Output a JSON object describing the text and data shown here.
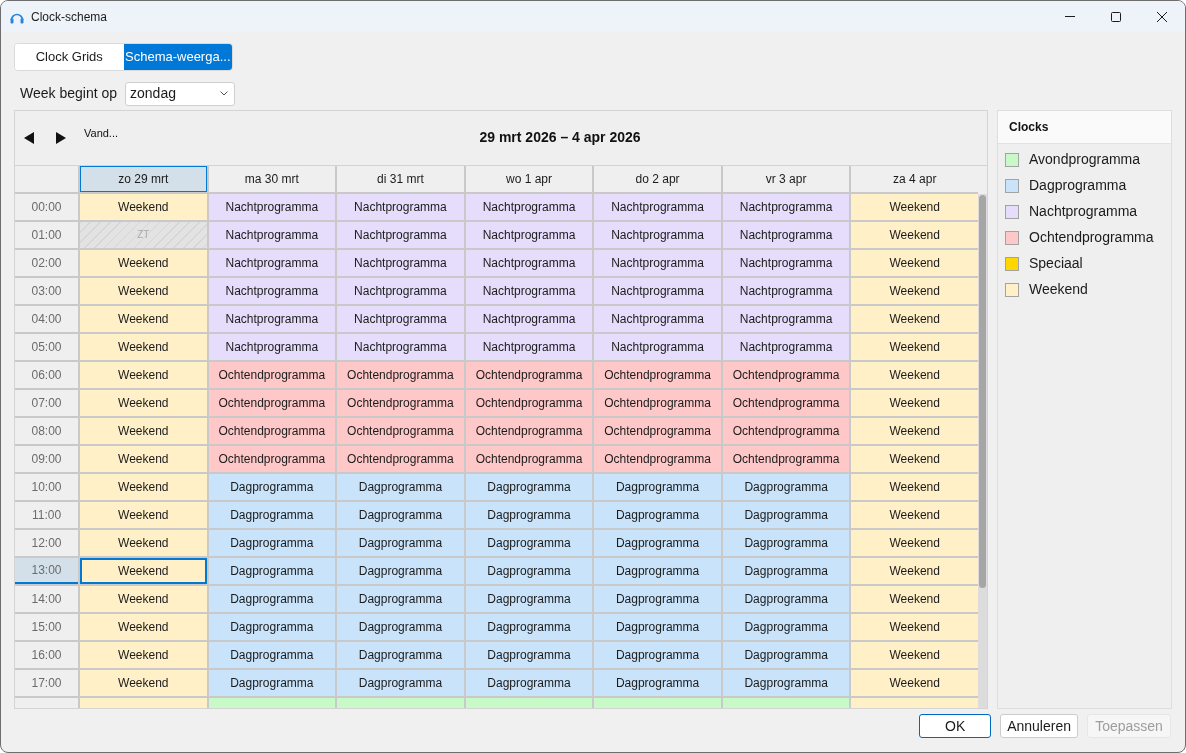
{
  "window": {
    "title": "Clock-schema"
  },
  "tabs": [
    {
      "label": "Clock Grids",
      "selected": false
    },
    {
      "label": "Schema-weerga...",
      "selected": true
    }
  ],
  "week_start": {
    "label": "Week begint op",
    "value": "zondag"
  },
  "navigation": {
    "today": "Vand...",
    "range_title": "29 mrt 2026 – 4 apr 2026"
  },
  "days": [
    {
      "label": "zo 29 mrt",
      "selected": true
    },
    {
      "label": "ma 30 mrt",
      "selected": false
    },
    {
      "label": "di 31 mrt",
      "selected": false
    },
    {
      "label": "wo 1 apr",
      "selected": false
    },
    {
      "label": "do 2 apr",
      "selected": false
    },
    {
      "label": "vr 3 apr",
      "selected": false
    },
    {
      "label": "za 4 apr",
      "selected": false
    }
  ],
  "rows": [
    {
      "time": "00:00",
      "selected": false,
      "cells": [
        {
          "kind": "clock",
          "label": "Weekend",
          "color": "#fff0c8",
          "selected": false
        },
        {
          "kind": "clock",
          "label": "Nachtprogramma",
          "color": "#e5ddfb",
          "selected": false
        },
        {
          "kind": "clock",
          "label": "Nachtprogramma",
          "color": "#e5ddfb",
          "selected": false
        },
        {
          "kind": "clock",
          "label": "Nachtprogramma",
          "color": "#e5ddfb",
          "selected": false
        },
        {
          "kind": "clock",
          "label": "Nachtprogramma",
          "color": "#e5ddfb",
          "selected": false
        },
        {
          "kind": "clock",
          "label": "Nachtprogramma",
          "color": "#e5ddfb",
          "selected": false
        },
        {
          "kind": "clock",
          "label": "Weekend",
          "color": "#fff0c8",
          "selected": false
        }
      ]
    },
    {
      "time": "01:00",
      "selected": false,
      "cells": [
        {
          "kind": "gap",
          "label": "ZT",
          "selected": false
        },
        {
          "kind": "clock",
          "label": "Nachtprogramma",
          "color": "#e5ddfb",
          "selected": false
        },
        {
          "kind": "clock",
          "label": "Nachtprogramma",
          "color": "#e5ddfb",
          "selected": false
        },
        {
          "kind": "clock",
          "label": "Nachtprogramma",
          "color": "#e5ddfb",
          "selected": false
        },
        {
          "kind": "clock",
          "label": "Nachtprogramma",
          "color": "#e5ddfb",
          "selected": false
        },
        {
          "kind": "clock",
          "label": "Nachtprogramma",
          "color": "#e5ddfb",
          "selected": false
        },
        {
          "kind": "clock",
          "label": "Weekend",
          "color": "#fff0c8",
          "selected": false
        }
      ]
    },
    {
      "time": "02:00",
      "selected": false,
      "cells": [
        {
          "kind": "clock",
          "label": "Weekend",
          "color": "#fff0c8",
          "selected": false
        },
        {
          "kind": "clock",
          "label": "Nachtprogramma",
          "color": "#e5ddfb",
          "selected": false
        },
        {
          "kind": "clock",
          "label": "Nachtprogramma",
          "color": "#e5ddfb",
          "selected": false
        },
        {
          "kind": "clock",
          "label": "Nachtprogramma",
          "color": "#e5ddfb",
          "selected": false
        },
        {
          "kind": "clock",
          "label": "Nachtprogramma",
          "color": "#e5ddfb",
          "selected": false
        },
        {
          "kind": "clock",
          "label": "Nachtprogramma",
          "color": "#e5ddfb",
          "selected": false
        },
        {
          "kind": "clock",
          "label": "Weekend",
          "color": "#fff0c8",
          "selected": false
        }
      ]
    },
    {
      "time": "03:00",
      "selected": false,
      "cells": [
        {
          "kind": "clock",
          "label": "Weekend",
          "color": "#fff0c8",
          "selected": false
        },
        {
          "kind": "clock",
          "label": "Nachtprogramma",
          "color": "#e5ddfb",
          "selected": false
        },
        {
          "kind": "clock",
          "label": "Nachtprogramma",
          "color": "#e5ddfb",
          "selected": false
        },
        {
          "kind": "clock",
          "label": "Nachtprogramma",
          "color": "#e5ddfb",
          "selected": false
        },
        {
          "kind": "clock",
          "label": "Nachtprogramma",
          "color": "#e5ddfb",
          "selected": false
        },
        {
          "kind": "clock",
          "label": "Nachtprogramma",
          "color": "#e5ddfb",
          "selected": false
        },
        {
          "kind": "clock",
          "label": "Weekend",
          "color": "#fff0c8",
          "selected": false
        }
      ]
    },
    {
      "time": "04:00",
      "selected": false,
      "cells": [
        {
          "kind": "clock",
          "label": "Weekend",
          "color": "#fff0c8",
          "selected": false
        },
        {
          "kind": "clock",
          "label": "Nachtprogramma",
          "color": "#e5ddfb",
          "selected": false
        },
        {
          "kind": "clock",
          "label": "Nachtprogramma",
          "color": "#e5ddfb",
          "selected": false
        },
        {
          "kind": "clock",
          "label": "Nachtprogramma",
          "color": "#e5ddfb",
          "selected": false
        },
        {
          "kind": "clock",
          "label": "Nachtprogramma",
          "color": "#e5ddfb",
          "selected": false
        },
        {
          "kind": "clock",
          "label": "Nachtprogramma",
          "color": "#e5ddfb",
          "selected": false
        },
        {
          "kind": "clock",
          "label": "Weekend",
          "color": "#fff0c8",
          "selected": false
        }
      ]
    },
    {
      "time": "05:00",
      "selected": false,
      "cells": [
        {
          "kind": "clock",
          "label": "Weekend",
          "color": "#fff0c8",
          "selected": false
        },
        {
          "kind": "clock",
          "label": "Nachtprogramma",
          "color": "#e5ddfb",
          "selected": false
        },
        {
          "kind": "clock",
          "label": "Nachtprogramma",
          "color": "#e5ddfb",
          "selected": false
        },
        {
          "kind": "clock",
          "label": "Nachtprogramma",
          "color": "#e5ddfb",
          "selected": false
        },
        {
          "kind": "clock",
          "label": "Nachtprogramma",
          "color": "#e5ddfb",
          "selected": false
        },
        {
          "kind": "clock",
          "label": "Nachtprogramma",
          "color": "#e5ddfb",
          "selected": false
        },
        {
          "kind": "clock",
          "label": "Weekend",
          "color": "#fff0c8",
          "selected": false
        }
      ]
    },
    {
      "time": "06:00",
      "selected": false,
      "cells": [
        {
          "kind": "clock",
          "label": "Weekend",
          "color": "#fff0c8",
          "selected": false
        },
        {
          "kind": "clock",
          "label": "Ochtendprogramma",
          "color": "#ffc8c8",
          "selected": false
        },
        {
          "kind": "clock",
          "label": "Ochtendprogramma",
          "color": "#ffc8c8",
          "selected": false
        },
        {
          "kind": "clock",
          "label": "Ochtendprogramma",
          "color": "#ffc8c8",
          "selected": false
        },
        {
          "kind": "clock",
          "label": "Ochtendprogramma",
          "color": "#ffc8c8",
          "selected": false
        },
        {
          "kind": "clock",
          "label": "Ochtendprogramma",
          "color": "#ffc8c8",
          "selected": false
        },
        {
          "kind": "clock",
          "label": "Weekend",
          "color": "#fff0c8",
          "selected": false
        }
      ]
    },
    {
      "time": "07:00",
      "selected": false,
      "cells": [
        {
          "kind": "clock",
          "label": "Weekend",
          "color": "#fff0c8",
          "selected": false
        },
        {
          "kind": "clock",
          "label": "Ochtendprogramma",
          "color": "#ffc8c8",
          "selected": false
        },
        {
          "kind": "clock",
          "label": "Ochtendprogramma",
          "color": "#ffc8c8",
          "selected": false
        },
        {
          "kind": "clock",
          "label": "Ochtendprogramma",
          "color": "#ffc8c8",
          "selected": false
        },
        {
          "kind": "clock",
          "label": "Ochtendprogramma",
          "color": "#ffc8c8",
          "selected": false
        },
        {
          "kind": "clock",
          "label": "Ochtendprogramma",
          "color": "#ffc8c8",
          "selected": false
        },
        {
          "kind": "clock",
          "label": "Weekend",
          "color": "#fff0c8",
          "selected": false
        }
      ]
    },
    {
      "time": "08:00",
      "selected": false,
      "cells": [
        {
          "kind": "clock",
          "label": "Weekend",
          "color": "#fff0c8",
          "selected": false
        },
        {
          "kind": "clock",
          "label": "Ochtendprogramma",
          "color": "#ffc8c8",
          "selected": false
        },
        {
          "kind": "clock",
          "label": "Ochtendprogramma",
          "color": "#ffc8c8",
          "selected": false
        },
        {
          "kind": "clock",
          "label": "Ochtendprogramma",
          "color": "#ffc8c8",
          "selected": false
        },
        {
          "kind": "clock",
          "label": "Ochtendprogramma",
          "color": "#ffc8c8",
          "selected": false
        },
        {
          "kind": "clock",
          "label": "Ochtendprogramma",
          "color": "#ffc8c8",
          "selected": false
        },
        {
          "kind": "clock",
          "label": "Weekend",
          "color": "#fff0c8",
          "selected": false
        }
      ]
    },
    {
      "time": "09:00",
      "selected": false,
      "cells": [
        {
          "kind": "clock",
          "label": "Weekend",
          "color": "#fff0c8",
          "selected": false
        },
        {
          "kind": "clock",
          "label": "Ochtendprogramma",
          "color": "#ffc8c8",
          "selected": false
        },
        {
          "kind": "clock",
          "label": "Ochtendprogramma",
          "color": "#ffc8c8",
          "selected": false
        },
        {
          "kind": "clock",
          "label": "Ochtendprogramma",
          "color": "#ffc8c8",
          "selected": false
        },
        {
          "kind": "clock",
          "label": "Ochtendprogramma",
          "color": "#ffc8c8",
          "selected": false
        },
        {
          "kind": "clock",
          "label": "Ochtendprogramma",
          "color": "#ffc8c8",
          "selected": false
        },
        {
          "kind": "clock",
          "label": "Weekend",
          "color": "#fff0c8",
          "selected": false
        }
      ]
    },
    {
      "time": "10:00",
      "selected": false,
      "cells": [
        {
          "kind": "clock",
          "label": "Weekend",
          "color": "#fff0c8",
          "selected": false
        },
        {
          "kind": "clock",
          "label": "Dagprogramma",
          "color": "#c8e3fa",
          "selected": false
        },
        {
          "kind": "clock",
          "label": "Dagprogramma",
          "color": "#c8e3fa",
          "selected": false
        },
        {
          "kind": "clock",
          "label": "Dagprogramma",
          "color": "#c8e3fa",
          "selected": false
        },
        {
          "kind": "clock",
          "label": "Dagprogramma",
          "color": "#c8e3fa",
          "selected": false
        },
        {
          "kind": "clock",
          "label": "Dagprogramma",
          "color": "#c8e3fa",
          "selected": false
        },
        {
          "kind": "clock",
          "label": "Weekend",
          "color": "#fff0c8",
          "selected": false
        }
      ]
    },
    {
      "time": "11:00",
      "selected": false,
      "cells": [
        {
          "kind": "clock",
          "label": "Weekend",
          "color": "#fff0c8",
          "selected": false
        },
        {
          "kind": "clock",
          "label": "Dagprogramma",
          "color": "#c8e3fa",
          "selected": false
        },
        {
          "kind": "clock",
          "label": "Dagprogramma",
          "color": "#c8e3fa",
          "selected": false
        },
        {
          "kind": "clock",
          "label": "Dagprogramma",
          "color": "#c8e3fa",
          "selected": false
        },
        {
          "kind": "clock",
          "label": "Dagprogramma",
          "color": "#c8e3fa",
          "selected": false
        },
        {
          "kind": "clock",
          "label": "Dagprogramma",
          "color": "#c8e3fa",
          "selected": false
        },
        {
          "kind": "clock",
          "label": "Weekend",
          "color": "#fff0c8",
          "selected": false
        }
      ]
    },
    {
      "time": "12:00",
      "selected": false,
      "cells": [
        {
          "kind": "clock",
          "label": "Weekend",
          "color": "#fff0c8",
          "selected": false
        },
        {
          "kind": "clock",
          "label": "Dagprogramma",
          "color": "#c8e3fa",
          "selected": false
        },
        {
          "kind": "clock",
          "label": "Dagprogramma",
          "color": "#c8e3fa",
          "selected": false
        },
        {
          "kind": "clock",
          "label": "Dagprogramma",
          "color": "#c8e3fa",
          "selected": false
        },
        {
          "kind": "clock",
          "label": "Dagprogramma",
          "color": "#c8e3fa",
          "selected": false
        },
        {
          "kind": "clock",
          "label": "Dagprogramma",
          "color": "#c8e3fa",
          "selected": false
        },
        {
          "kind": "clock",
          "label": "Weekend",
          "color": "#fff0c8",
          "selected": false
        }
      ]
    },
    {
      "time": "13:00",
      "selected": true,
      "cells": [
        {
          "kind": "clock",
          "label": "Weekend",
          "color": "#fff0c8",
          "selected": true
        },
        {
          "kind": "clock",
          "label": "Dagprogramma",
          "color": "#c8e3fa",
          "selected": false
        },
        {
          "kind": "clock",
          "label": "Dagprogramma",
          "color": "#c8e3fa",
          "selected": false
        },
        {
          "kind": "clock",
          "label": "Dagprogramma",
          "color": "#c8e3fa",
          "selected": false
        },
        {
          "kind": "clock",
          "label": "Dagprogramma",
          "color": "#c8e3fa",
          "selected": false
        },
        {
          "kind": "clock",
          "label": "Dagprogramma",
          "color": "#c8e3fa",
          "selected": false
        },
        {
          "kind": "clock",
          "label": "Weekend",
          "color": "#fff0c8",
          "selected": false
        }
      ]
    },
    {
      "time": "14:00",
      "selected": false,
      "cells": [
        {
          "kind": "clock",
          "label": "Weekend",
          "color": "#fff0c8",
          "selected": false
        },
        {
          "kind": "clock",
          "label": "Dagprogramma",
          "color": "#c8e3fa",
          "selected": false
        },
        {
          "kind": "clock",
          "label": "Dagprogramma",
          "color": "#c8e3fa",
          "selected": false
        },
        {
          "kind": "clock",
          "label": "Dagprogramma",
          "color": "#c8e3fa",
          "selected": false
        },
        {
          "kind": "clock",
          "label": "Dagprogramma",
          "color": "#c8e3fa",
          "selected": false
        },
        {
          "kind": "clock",
          "label": "Dagprogramma",
          "color": "#c8e3fa",
          "selected": false
        },
        {
          "kind": "clock",
          "label": "Weekend",
          "color": "#fff0c8",
          "selected": false
        }
      ]
    },
    {
      "time": "15:00",
      "selected": false,
      "cells": [
        {
          "kind": "clock",
          "label": "Weekend",
          "color": "#fff0c8",
          "selected": false
        },
        {
          "kind": "clock",
          "label": "Dagprogramma",
          "color": "#c8e3fa",
          "selected": false
        },
        {
          "kind": "clock",
          "label": "Dagprogramma",
          "color": "#c8e3fa",
          "selected": false
        },
        {
          "kind": "clock",
          "label": "Dagprogramma",
          "color": "#c8e3fa",
          "selected": false
        },
        {
          "kind": "clock",
          "label": "Dagprogramma",
          "color": "#c8e3fa",
          "selected": false
        },
        {
          "kind": "clock",
          "label": "Dagprogramma",
          "color": "#c8e3fa",
          "selected": false
        },
        {
          "kind": "clock",
          "label": "Weekend",
          "color": "#fff0c8",
          "selected": false
        }
      ]
    },
    {
      "time": "16:00",
      "selected": false,
      "cells": [
        {
          "kind": "clock",
          "label": "Weekend",
          "color": "#fff0c8",
          "selected": false
        },
        {
          "kind": "clock",
          "label": "Dagprogramma",
          "color": "#c8e3fa",
          "selected": false
        },
        {
          "kind": "clock",
          "label": "Dagprogramma",
          "color": "#c8e3fa",
          "selected": false
        },
        {
          "kind": "clock",
          "label": "Dagprogramma",
          "color": "#c8e3fa",
          "selected": false
        },
        {
          "kind": "clock",
          "label": "Dagprogramma",
          "color": "#c8e3fa",
          "selected": false
        },
        {
          "kind": "clock",
          "label": "Dagprogramma",
          "color": "#c8e3fa",
          "selected": false
        },
        {
          "kind": "clock",
          "label": "Weekend",
          "color": "#fff0c8",
          "selected": false
        }
      ]
    },
    {
      "time": "17:00",
      "selected": false,
      "cells": [
        {
          "kind": "clock",
          "label": "Weekend",
          "color": "#fff0c8",
          "selected": false
        },
        {
          "kind": "clock",
          "label": "Dagprogramma",
          "color": "#c8e3fa",
          "selected": false
        },
        {
          "kind": "clock",
          "label": "Dagprogramma",
          "color": "#c8e3fa",
          "selected": false
        },
        {
          "kind": "clock",
          "label": "Dagprogramma",
          "color": "#c8e3fa",
          "selected": false
        },
        {
          "kind": "clock",
          "label": "Dagprogramma",
          "color": "#c8e3fa",
          "selected": false
        },
        {
          "kind": "clock",
          "label": "Dagprogramma",
          "color": "#c8e3fa",
          "selected": false
        },
        {
          "kind": "clock",
          "label": "Weekend",
          "color": "#fff0c8",
          "selected": false
        }
      ]
    },
    {
      "selected": false,
      "cells": [
        {
          "kind": "clock",
          "color": "#fff0c8",
          "selected": false
        },
        {
          "kind": "clock",
          "color": "#c8fac8",
          "selected": false
        },
        {
          "kind": "clock",
          "color": "#c8fac8",
          "selected": false
        },
        {
          "kind": "clock",
          "color": "#c8fac8",
          "selected": false
        },
        {
          "kind": "clock",
          "color": "#c8fac8",
          "selected": false
        },
        {
          "kind": "clock",
          "color": "#c8fac8",
          "selected": false
        },
        {
          "kind": "clock",
          "color": "#fff0c8",
          "selected": false
        }
      ]
    }
  ],
  "legend": {
    "title": "Clocks",
    "items": [
      {
        "label": "Avondprogramma",
        "color": "#c8fac8"
      },
      {
        "label": "Dagprogramma",
        "color": "#c8e3fa"
      },
      {
        "label": "Nachtprogramma",
        "color": "#e5ddfb"
      },
      {
        "label": "Ochtendprogramma",
        "color": "#ffc8c8"
      },
      {
        "label": "Speciaal",
        "color": "#ffd700"
      },
      {
        "label": "Weekend",
        "color": "#fff0c8"
      }
    ]
  },
  "buttons": [
    {
      "label": "OK",
      "default": true,
      "disabled": false
    },
    {
      "label": "Annuleren",
      "default": false,
      "disabled": false
    },
    {
      "label": "Toepassen",
      "default": false,
      "disabled": true
    }
  ]
}
